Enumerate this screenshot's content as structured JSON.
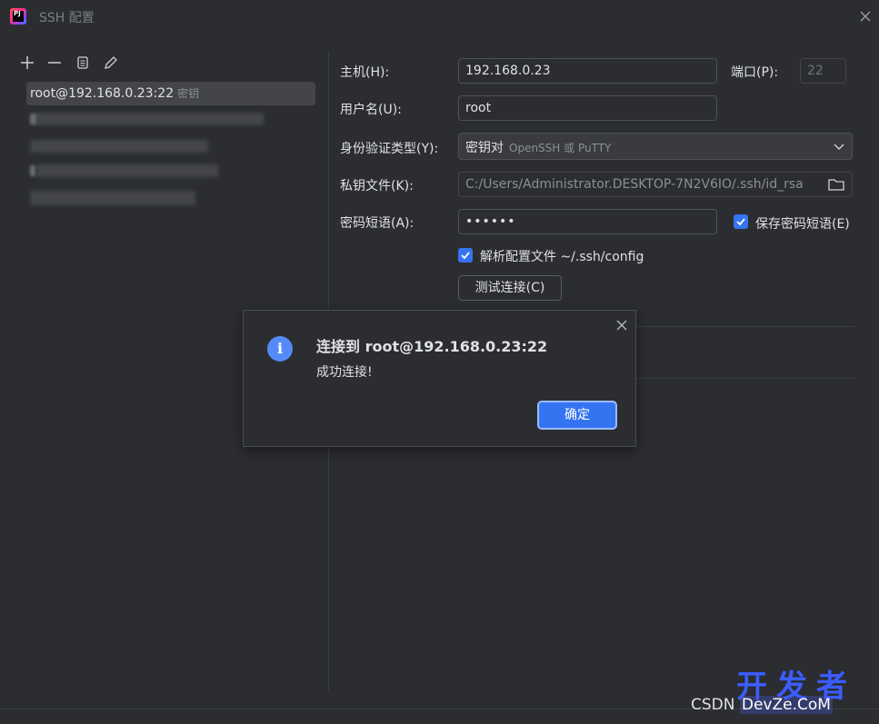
{
  "window": {
    "title": "SSH 配置"
  },
  "toolbar": {
    "add": "+",
    "remove": "−"
  },
  "list": {
    "selected_host": "root@192.168.0.23:22",
    "selected_auth": "密钥"
  },
  "form": {
    "host_label": "主机(H):",
    "host_value": "192.168.0.23",
    "port_label": "端口(P):",
    "port_value": "22",
    "user_label": "用户名(U):",
    "user_value": "root",
    "auth_label": "身份验证类型(Y):",
    "auth_value": "密钥对",
    "auth_hint": "OpenSSH 或 PuTTY",
    "key_label": "私钥文件(K):",
    "key_value": "C:/Users/Administrator.DESKTOP-7N2V6IO/.ssh/id_rsa",
    "pass_label": "密码短语(A):",
    "pass_value": "••••••",
    "save_pass_label": "保存密码短语(E)",
    "parse_config_label": "解析配置文件 ~/.ssh/config",
    "test_button": "测试连接(C)"
  },
  "dialog": {
    "title": "连接到 root@192.168.0.23:22",
    "message": "成功连接!",
    "ok_button": "确定"
  },
  "watermark": {
    "big": "开发者",
    "small_prefix": "CSDN",
    "small_domain": "DevZe.CoM"
  },
  "colors": {
    "accent": "#3574f0",
    "info": "#548af7",
    "background": "#2b2d30"
  }
}
